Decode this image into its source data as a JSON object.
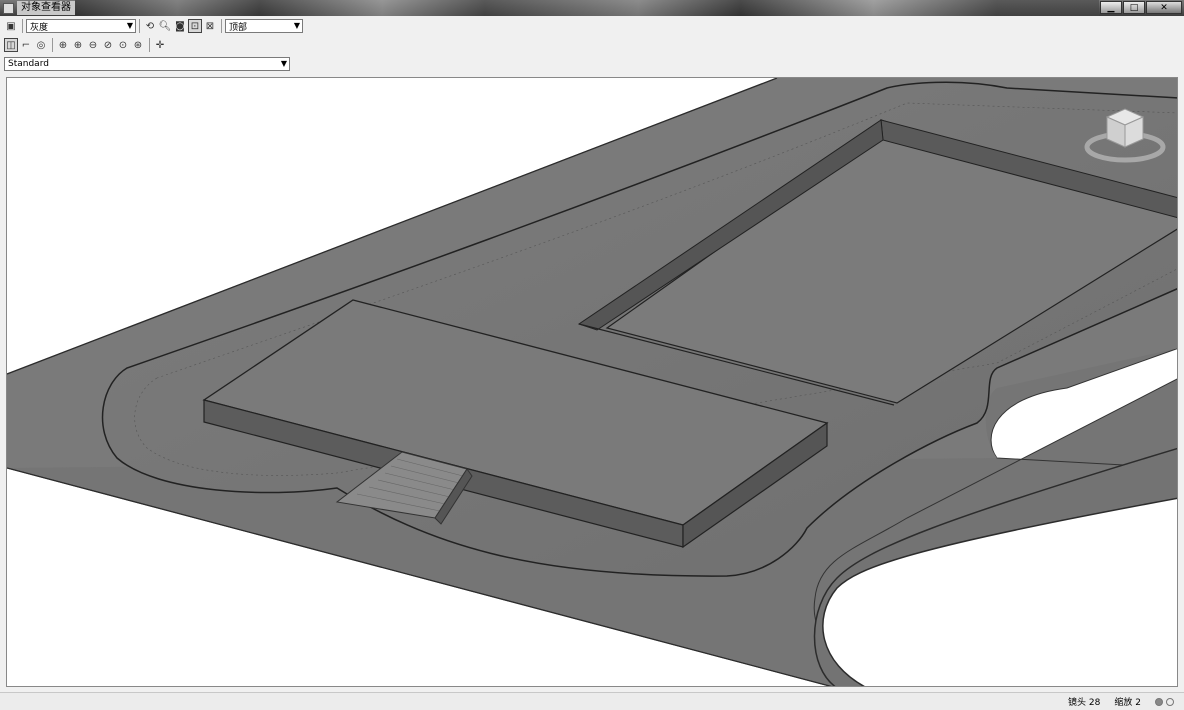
{
  "window": {
    "title": "对象查看器"
  },
  "toolbar1": {
    "visual_style": "灰度",
    "view": "顶部"
  },
  "toolbar3": {
    "preset": "Standard"
  },
  "status": {
    "lens_label": "镜头",
    "lens_value": "28",
    "zoom_label": "缩放",
    "zoom_value": "2"
  },
  "colors": {
    "surface": "#777777",
    "wall_side": "#5a5a5a",
    "background": "#ffffff"
  }
}
